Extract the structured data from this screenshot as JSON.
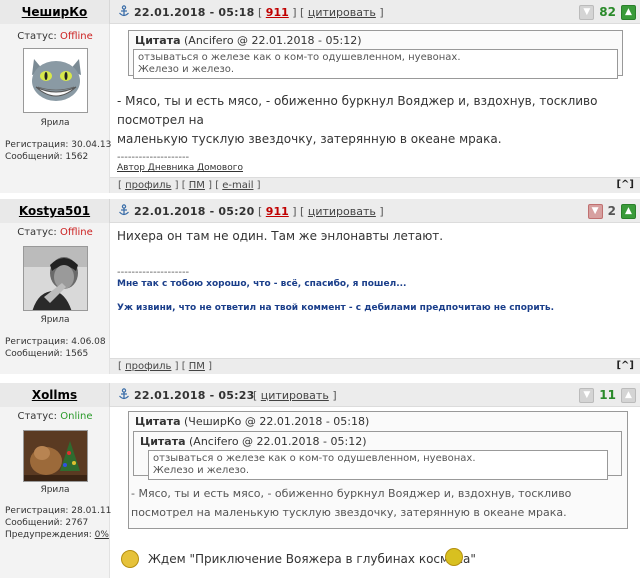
{
  "posts": [
    {
      "author": "ЧеширКо",
      "status_label": "Статус:",
      "status_value": "Offline",
      "avatar_caption": "Ярила",
      "reg_label": "Регистрация:",
      "reg_value": "30.04.13",
      "msgs_label": "Сообщений:",
      "msgs_value": "1562",
      "date": "22.01.2018 - 05:18",
      "post_num": "911",
      "quote_btn": "цитировать",
      "rating": "82",
      "quote": {
        "title": "Цитата",
        "source": "(Ancifero @ 22.01.2018 - 05:12)",
        "lines": [
          "отзываться о железе как о ком-то одушевленном, нуевонах.",
          "Железо и железо."
        ]
      },
      "text": [
        "- Мясо, ты и есть мясо, - обиженно буркнул Вояджер и, вздохнув, тоскливо посмотрел на",
        "маленькую тусклую звездочку, затерянную в океане мрака."
      ],
      "sig_sep": "--------------------",
      "sig_link": "Автор Дневника Домового",
      "footer_links": [
        "профиль",
        "ПМ",
        "e-mail"
      ],
      "up": "[^]"
    },
    {
      "author": "Kostya501",
      "status_label": "Статус:",
      "status_value": "Offline",
      "avatar_caption": "Ярила",
      "reg_label": "Регистрация:",
      "reg_value": "4.06.08",
      "msgs_label": "Сообщений:",
      "msgs_value": "1565",
      "date": "22.01.2018 - 05:20",
      "post_num": "911",
      "quote_btn": "цитировать",
      "rating": "2",
      "text": [
        "Нихера он там не один. Там же энлонавты летают."
      ],
      "sig_sep": "--------------------",
      "sig_lines": [
        "Мне так с тобою хорошо, что - всё, спасибо, я пошел...",
        "Уж извини, что не ответил на твой коммент - с дебилами предпочитаю не спорить."
      ],
      "footer_links": [
        "профиль",
        "ПМ"
      ],
      "up": "[^]"
    },
    {
      "author": "Xollms",
      "status_label": "Статус:",
      "status_value": "Online",
      "avatar_caption": "Ярила",
      "reg_label": "Регистрация:",
      "reg_value": "28.01.11",
      "msgs_label": "Сообщений:",
      "msgs_value": "2767",
      "warn_label": "Предупреждения:",
      "warn_value": "0%",
      "date": "22.01.2018 - 05:23",
      "quote_btn": "цитировать",
      "rating": "11",
      "quote": {
        "title": "Цитата",
        "source": "(ЧеширКо @ 22.01.2018 - 05:18)",
        "inner_title": "Цитата",
        "inner_source": "(Ancifero @ 22.01.2018 - 05:12)",
        "inner_lines": [
          "отзываться о железе как о ком-то одушевленном, нуевонах.",
          "Железо и железо."
        ],
        "lines": [
          "- Мясо, ты и есть мясо, - обиженно буркнул Вояджер и, вздохнув, тоскливо",
          "посмотрел на маленькую тусклую звездочку, затерянную в океане мрака."
        ]
      },
      "text": [
        "Ждем \"Приключение Вояжера в глубинах космоса\""
      ]
    }
  ],
  "colors": {
    "offline": "#cc2222",
    "online": "#2a9a2a",
    "post_number": "#c00000",
    "rating_green": "#2a8a2a"
  }
}
